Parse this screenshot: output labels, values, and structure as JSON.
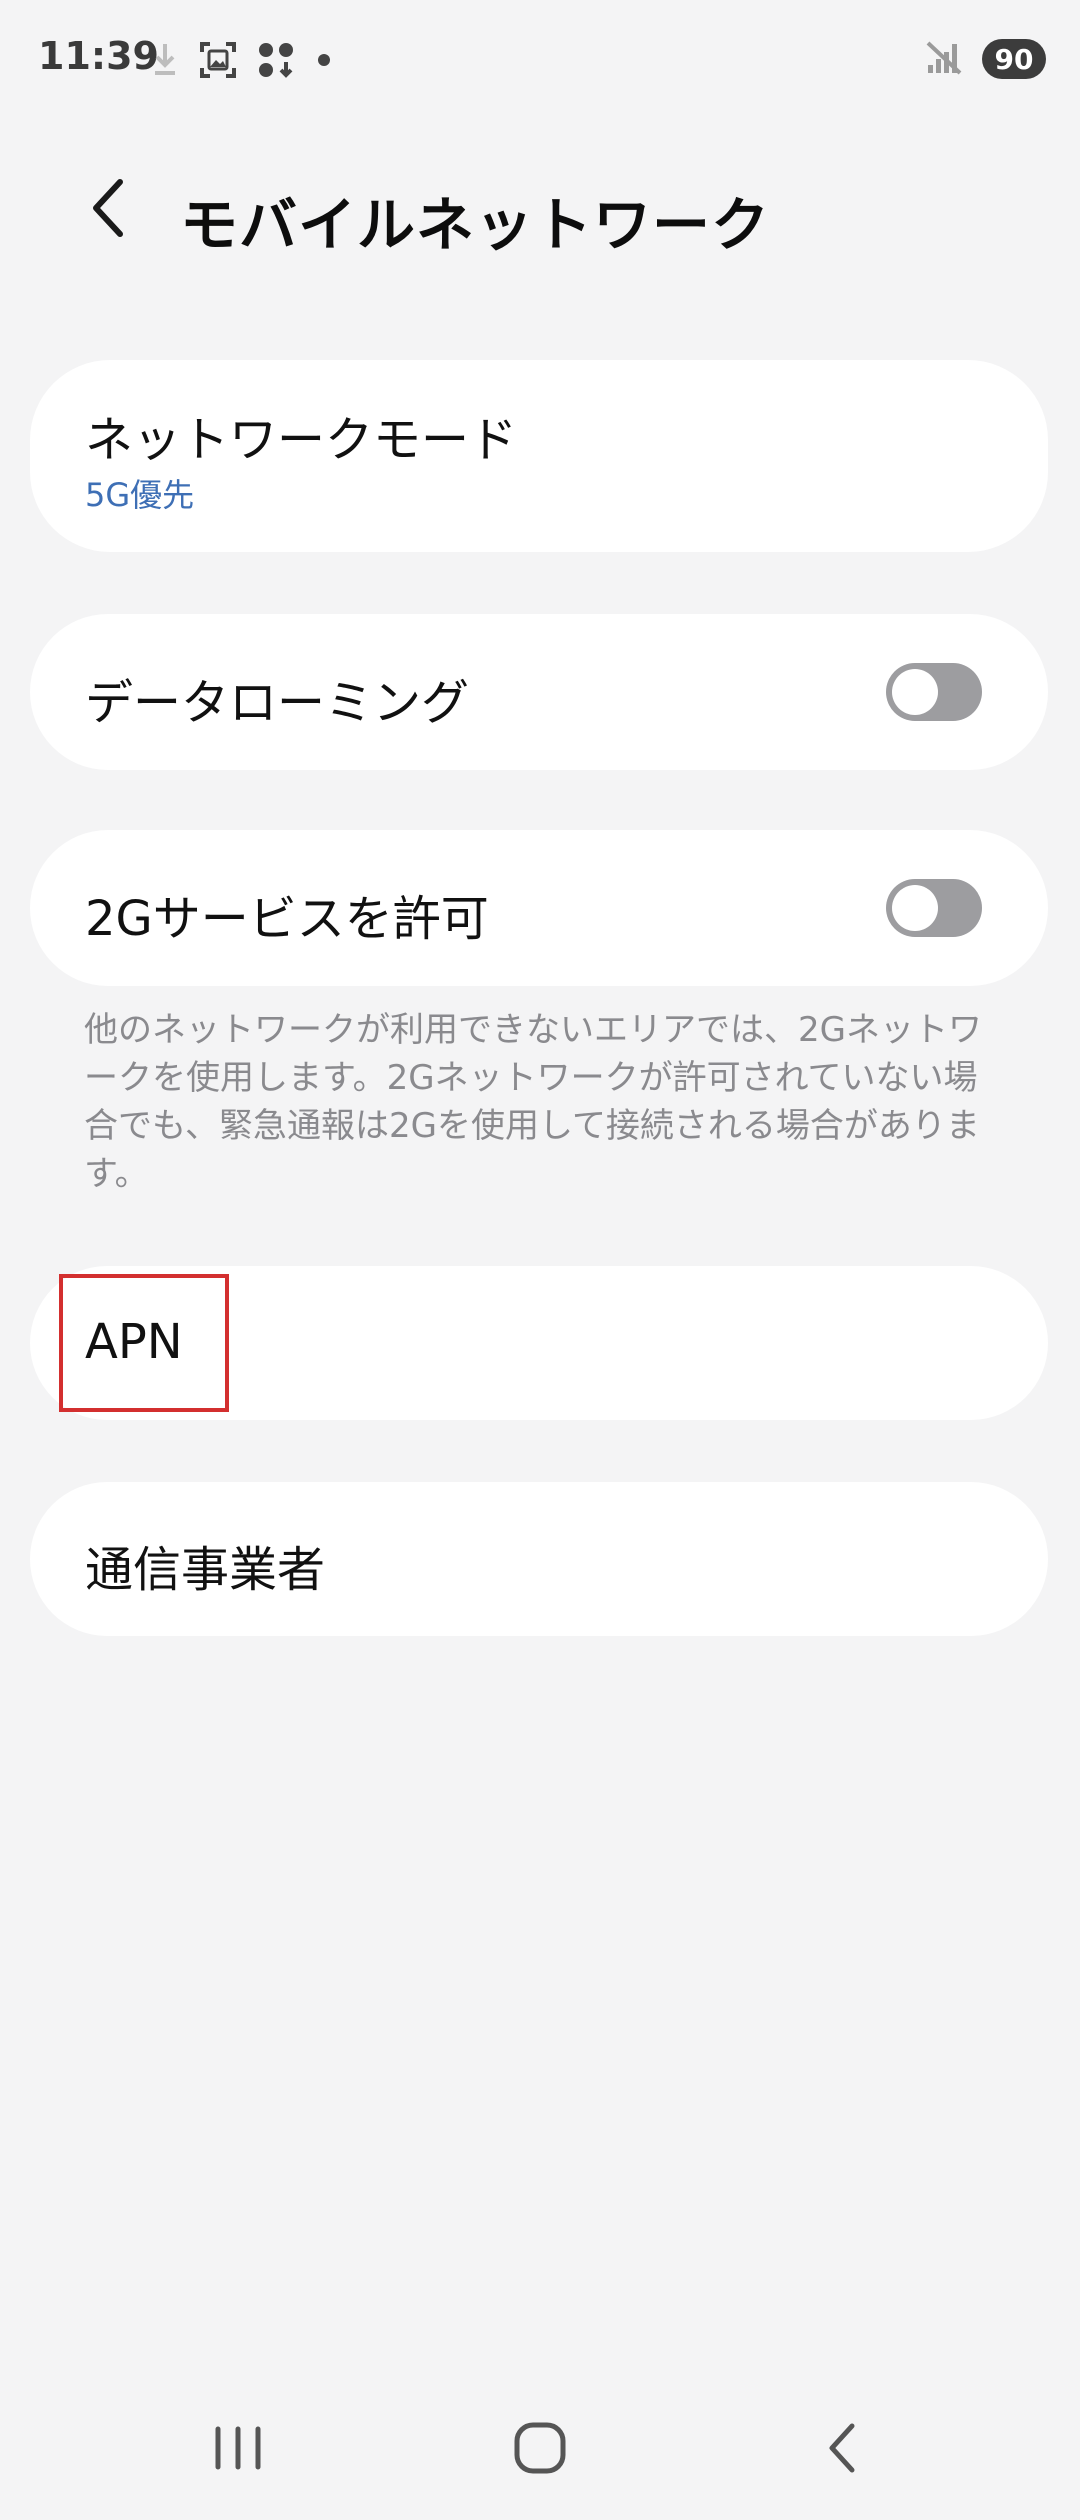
{
  "status_bar": {
    "time": "11:39",
    "battery": "90",
    "icons": [
      "download-icon",
      "screenshot-icon",
      "app-grid-icon",
      "notification-dot-icon",
      "no-signal-icon"
    ]
  },
  "header": {
    "title": "モバイルネットワーク",
    "back_icon": "chevron-left-icon"
  },
  "settings": {
    "network_mode": {
      "label": "ネットワークモード",
      "value": "5G優先"
    },
    "data_roaming": {
      "label": "データローミング",
      "enabled": false
    },
    "allow_2g": {
      "label": "2Gサービスを許可",
      "enabled": false
    },
    "allow_2g_note": "他のネットワークが利用できないエリアでは、2Gネットワークを使用します。2Gネットワークが許可されていない場合でも、緊急通報は2Gを使用して接続される場合があります。",
    "apn": {
      "label": "APN"
    },
    "carrier": {
      "label": "通信事業者"
    }
  },
  "colors": {
    "background": "#f4f4f5",
    "card": "#ffffff",
    "accent_blue": "#3e6fb5",
    "toggle_off": "#9d9da0",
    "highlight_red": "#d32f2f"
  },
  "nav_bar": {
    "icons": [
      "recent-apps-icon",
      "home-icon",
      "back-icon"
    ]
  }
}
